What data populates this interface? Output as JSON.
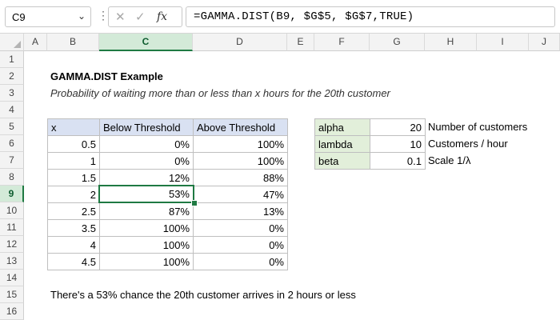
{
  "formula_bar": {
    "name_box": "C9",
    "formula": "=GAMMA.DIST(B9, $G$5, $G$7,TRUE)",
    "fx_label": "fx"
  },
  "columns": [
    "A",
    "B",
    "C",
    "D",
    "E",
    "F",
    "G",
    "H",
    "I",
    "J"
  ],
  "rows": [
    "1",
    "2",
    "3",
    "4",
    "5",
    "6",
    "7",
    "8",
    "9",
    "10",
    "11",
    "12",
    "13",
    "14",
    "15",
    "16"
  ],
  "selected": {
    "column": "C",
    "row": "9"
  },
  "title": "GAMMA.DIST Example",
  "subtitle": "Probability of waiting more than or less than x hours for the 20th customer",
  "table": {
    "headers": [
      "x",
      "Below Threshold",
      "Above Threshold"
    ],
    "rows": [
      [
        "0.5",
        "0%",
        "100%"
      ],
      [
        "1",
        "0%",
        "100%"
      ],
      [
        "1.5",
        "12%",
        "88%"
      ],
      [
        "2",
        "53%",
        "47%"
      ],
      [
        "2.5",
        "87%",
        "13%"
      ],
      [
        "3.5",
        "100%",
        "0%"
      ],
      [
        "4",
        "100%",
        "0%"
      ],
      [
        "4.5",
        "100%",
        "0%"
      ]
    ]
  },
  "params": [
    {
      "label": "alpha",
      "value": "20",
      "note": "Number of customers"
    },
    {
      "label": "lambda",
      "value": "10",
      "note": "Customers / hour"
    },
    {
      "label": "beta",
      "value": "0.1",
      "note": "Scale 1/λ"
    }
  ],
  "summary": "There's a 53% chance the 20th customer arrives in 2 hours or less",
  "colors": {
    "selection": "#1f7a43",
    "table_header": "#d9e1f2",
    "param_label": "#e2efda"
  }
}
